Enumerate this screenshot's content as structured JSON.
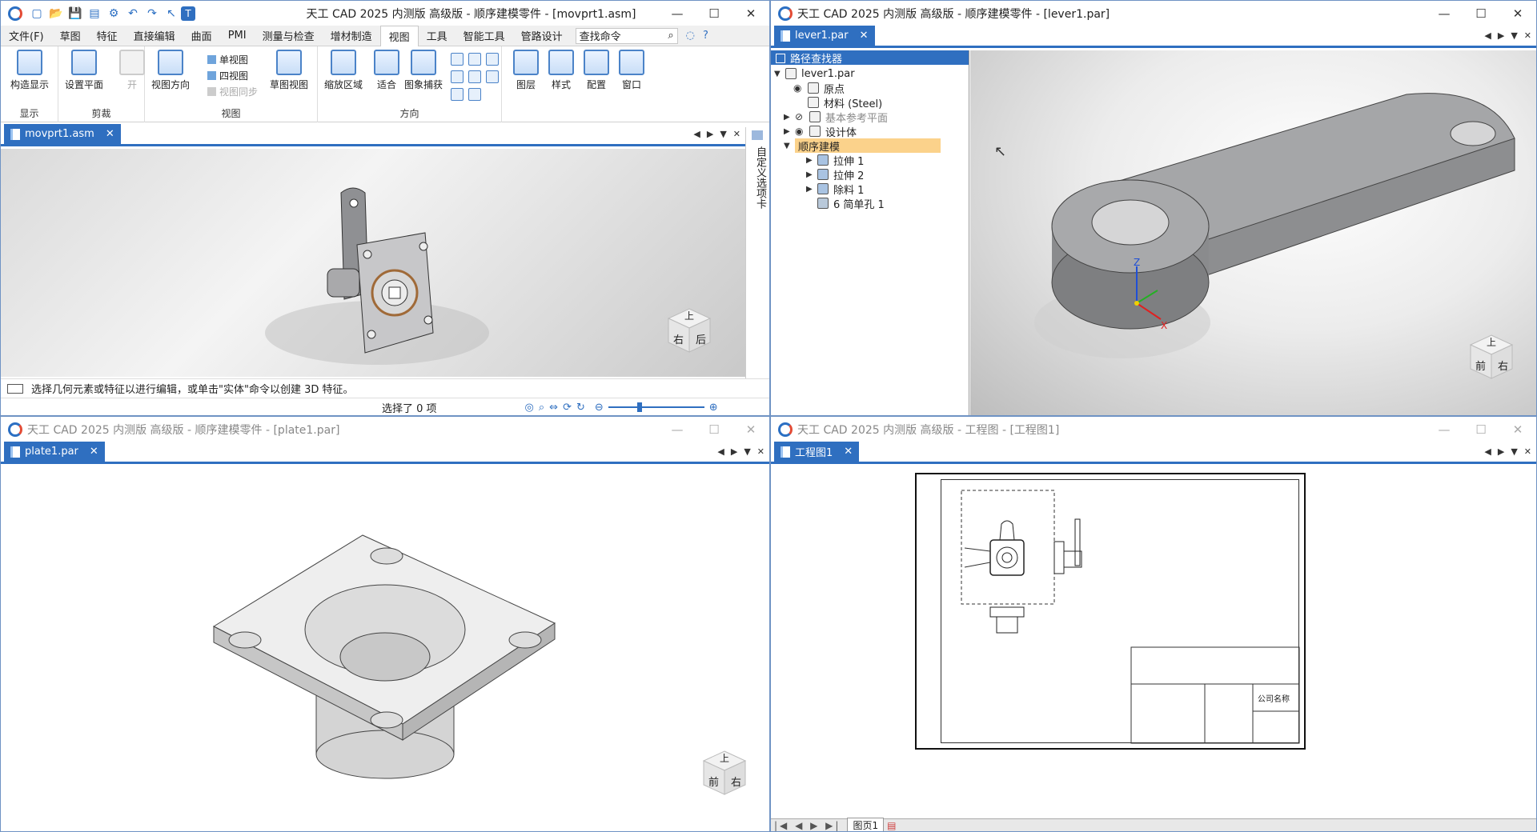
{
  "win1": {
    "title": "天工 CAD 2025 内测版 高级版 - 顺序建模零件 - [movprt1.asm]",
    "tabs": [
      "文件(F)",
      "草图",
      "特征",
      "直接编辑",
      "曲面",
      "PMI",
      "测量与检查",
      "增材制造",
      "视图",
      "工具",
      "智能工具",
      "管路设计"
    ],
    "active_tab": "视图",
    "find_placeholder": "查找命令",
    "ribbon": {
      "group_display": "显示",
      "btn_construct": "构造显示",
      "group_clip": "剪裁",
      "btn_setplane": "设置平面",
      "btn_open": "开",
      "group_view": "视图",
      "btn_vieworient": "视图方向",
      "btn_single": "单视图",
      "btn_quad": "四视图",
      "btn_sync": "视图同步",
      "btn_sketchview": "草图视图",
      "group_orient": "方向",
      "btn_zoomarea": "缩放区域",
      "btn_fit": "适合",
      "btn_capture": "图象捕获",
      "btn_layers": "图层",
      "btn_style": "样式",
      "btn_config": "配置",
      "btn_window": "窗口"
    },
    "doc_tab": "movprt1.asm",
    "side_panel": "自定义选项卡",
    "prompt": "选择几何元素或特征以进行编辑，或单击\"实体\"命令以创建 3D 特征。",
    "selection": "选择了 0 项",
    "cube": {
      "top": "上",
      "right": "后",
      "left": "右"
    }
  },
  "win2": {
    "title": "天工 CAD 2025 内测版 高级版 - 顺序建模零件 - [lever1.par]",
    "doc_tab": "lever1.par",
    "path_finder": "路径查找器",
    "tree": [
      {
        "label": "lever1.par"
      },
      {
        "label": "原点"
      },
      {
        "label": "材料 (Steel)"
      },
      {
        "label": "基本参考平面"
      },
      {
        "label": "设计体"
      },
      {
        "label": "顺序建模"
      },
      {
        "label": "拉伸 1"
      },
      {
        "label": "拉伸 2"
      },
      {
        "label": "除料 1"
      },
      {
        "label": "6 简单孔 1"
      }
    ],
    "axis_z": "Z",
    "cube": {
      "top": "上",
      "left": "前",
      "right": "右"
    }
  },
  "win3": {
    "title": "天工 CAD 2025 内测版 高级版 - 顺序建模零件 - [plate1.par]",
    "doc_tab": "plate1.par",
    "cube": {
      "top": "上",
      "left": "前",
      "right": "右"
    }
  },
  "win4": {
    "title": "天工 CAD 2025 内测版 高级版 - 工程图 - [工程图1]",
    "doc_tab": "工程图1",
    "sheet_tab": "图页1",
    "company": "公司名称"
  },
  "colors": {
    "accent": "#2f6fc0",
    "highlight": "#fbd28b"
  }
}
